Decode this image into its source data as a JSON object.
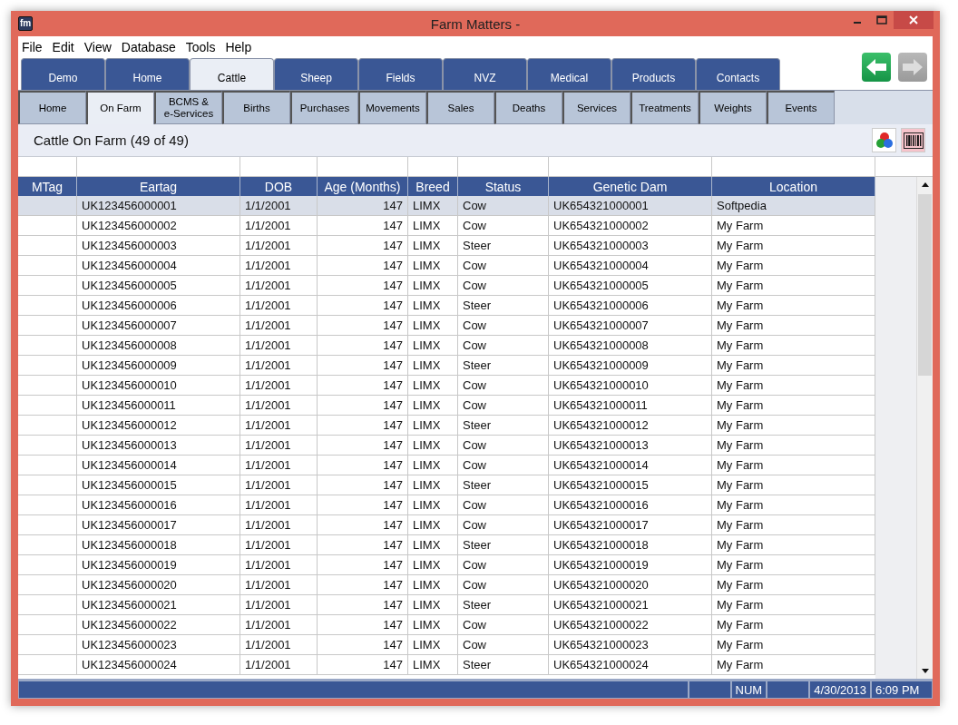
{
  "window": {
    "title": "Farm Matters -",
    "logo_text": "fm"
  },
  "menu": [
    "File",
    "Edit",
    "View",
    "Database",
    "Tools",
    "Help"
  ],
  "tabs": [
    {
      "label": "Demo",
      "selected": false
    },
    {
      "label": "Home",
      "selected": false
    },
    {
      "label": "Cattle",
      "selected": true
    },
    {
      "label": "Sheep",
      "selected": false
    },
    {
      "label": "Fields",
      "selected": false
    },
    {
      "label": "NVZ",
      "selected": false
    },
    {
      "label": "Medical",
      "selected": false
    },
    {
      "label": "Products",
      "selected": false
    },
    {
      "label": "Contacts",
      "selected": false
    }
  ],
  "nav": [
    {
      "kind": "back",
      "disabled": false
    },
    {
      "kind": "forward",
      "disabled": true
    }
  ],
  "subtabs": [
    {
      "label": "Home",
      "selected": false
    },
    {
      "label": "On Farm",
      "selected": true
    },
    {
      "label": "BCMS &\ne-Services",
      "selected": false
    },
    {
      "label": "Births",
      "selected": false
    },
    {
      "label": "Purchases",
      "selected": false
    },
    {
      "label": "Movements",
      "selected": false
    },
    {
      "label": "Sales",
      "selected": false
    },
    {
      "label": "Deaths",
      "selected": false
    },
    {
      "label": "Services",
      "selected": false
    },
    {
      "label": "Treatments",
      "selected": false
    },
    {
      "label": "Weights",
      "selected": false
    },
    {
      "label": "Events",
      "selected": false
    }
  ],
  "page_title": "Cattle On Farm (49 of 49)",
  "table": {
    "columns": [
      "MTag",
      "Eartag",
      "DOB",
      "Age (Months)",
      "Breed",
      "Status",
      "Genetic Dam",
      "Location"
    ],
    "rows": [
      {
        "selected": true,
        "cells": [
          "",
          "UK123456000001",
          "1/1/2001",
          "147",
          "LIMX",
          "Cow",
          "UK654321000001",
          "Softpedia"
        ]
      },
      {
        "selected": false,
        "cells": [
          "",
          "UK123456000002",
          "1/1/2001",
          "147",
          "LIMX",
          "Cow",
          "UK654321000002",
          "My Farm"
        ]
      },
      {
        "selected": false,
        "cells": [
          "",
          "UK123456000003",
          "1/1/2001",
          "147",
          "LIMX",
          "Steer",
          "UK654321000003",
          "My Farm"
        ]
      },
      {
        "selected": false,
        "cells": [
          "",
          "UK123456000004",
          "1/1/2001",
          "147",
          "LIMX",
          "Cow",
          "UK654321000004",
          "My Farm"
        ]
      },
      {
        "selected": false,
        "cells": [
          "",
          "UK123456000005",
          "1/1/2001",
          "147",
          "LIMX",
          "Cow",
          "UK654321000005",
          "My Farm"
        ]
      },
      {
        "selected": false,
        "cells": [
          "",
          "UK123456000006",
          "1/1/2001",
          "147",
          "LIMX",
          "Steer",
          "UK654321000006",
          "My Farm"
        ]
      },
      {
        "selected": false,
        "cells": [
          "",
          "UK123456000007",
          "1/1/2001",
          "147",
          "LIMX",
          "Cow",
          "UK654321000007",
          "My Farm"
        ]
      },
      {
        "selected": false,
        "cells": [
          "",
          "UK123456000008",
          "1/1/2001",
          "147",
          "LIMX",
          "Cow",
          "UK654321000008",
          "My Farm"
        ]
      },
      {
        "selected": false,
        "cells": [
          "",
          "UK123456000009",
          "1/1/2001",
          "147",
          "LIMX",
          "Steer",
          "UK654321000009",
          "My Farm"
        ]
      },
      {
        "selected": false,
        "cells": [
          "",
          "UK123456000010",
          "1/1/2001",
          "147",
          "LIMX",
          "Cow",
          "UK654321000010",
          "My Farm"
        ]
      },
      {
        "selected": false,
        "cells": [
          "",
          "UK123456000011",
          "1/1/2001",
          "147",
          "LIMX",
          "Cow",
          "UK654321000011",
          "My Farm"
        ]
      },
      {
        "selected": false,
        "cells": [
          "",
          "UK123456000012",
          "1/1/2001",
          "147",
          "LIMX",
          "Steer",
          "UK654321000012",
          "My Farm"
        ]
      },
      {
        "selected": false,
        "cells": [
          "",
          "UK123456000013",
          "1/1/2001",
          "147",
          "LIMX",
          "Cow",
          "UK654321000013",
          "My Farm"
        ]
      },
      {
        "selected": false,
        "cells": [
          "",
          "UK123456000014",
          "1/1/2001",
          "147",
          "LIMX",
          "Cow",
          "UK654321000014",
          "My Farm"
        ]
      },
      {
        "selected": false,
        "cells": [
          "",
          "UK123456000015",
          "1/1/2001",
          "147",
          "LIMX",
          "Steer",
          "UK654321000015",
          "My Farm"
        ]
      },
      {
        "selected": false,
        "cells": [
          "",
          "UK123456000016",
          "1/1/2001",
          "147",
          "LIMX",
          "Cow",
          "UK654321000016",
          "My Farm"
        ]
      },
      {
        "selected": false,
        "cells": [
          "",
          "UK123456000017",
          "1/1/2001",
          "147",
          "LIMX",
          "Cow",
          "UK654321000017",
          "My Farm"
        ]
      },
      {
        "selected": false,
        "cells": [
          "",
          "UK123456000018",
          "1/1/2001",
          "147",
          "LIMX",
          "Steer",
          "UK654321000018",
          "My Farm"
        ]
      },
      {
        "selected": false,
        "cells": [
          "",
          "UK123456000019",
          "1/1/2001",
          "147",
          "LIMX",
          "Cow",
          "UK654321000019",
          "My Farm"
        ]
      },
      {
        "selected": false,
        "cells": [
          "",
          "UK123456000020",
          "1/1/2001",
          "147",
          "LIMX",
          "Cow",
          "UK654321000020",
          "My Farm"
        ]
      },
      {
        "selected": false,
        "cells": [
          "",
          "UK123456000021",
          "1/1/2001",
          "147",
          "LIMX",
          "Steer",
          "UK654321000021",
          "My Farm"
        ]
      },
      {
        "selected": false,
        "cells": [
          "",
          "UK123456000022",
          "1/1/2001",
          "147",
          "LIMX",
          "Cow",
          "UK654321000022",
          "My Farm"
        ]
      },
      {
        "selected": false,
        "cells": [
          "",
          "UK123456000023",
          "1/1/2001",
          "147",
          "LIMX",
          "Cow",
          "UK654321000023",
          "My Farm"
        ]
      },
      {
        "selected": false,
        "cells": [
          "",
          "UK123456000024",
          "1/1/2001",
          "147",
          "LIMX",
          "Steer",
          "UK654321000024",
          "My Farm"
        ]
      }
    ]
  },
  "status_bar": {
    "num": "NUM",
    "date": "4/30/2013",
    "time": "6:09 PM"
  }
}
